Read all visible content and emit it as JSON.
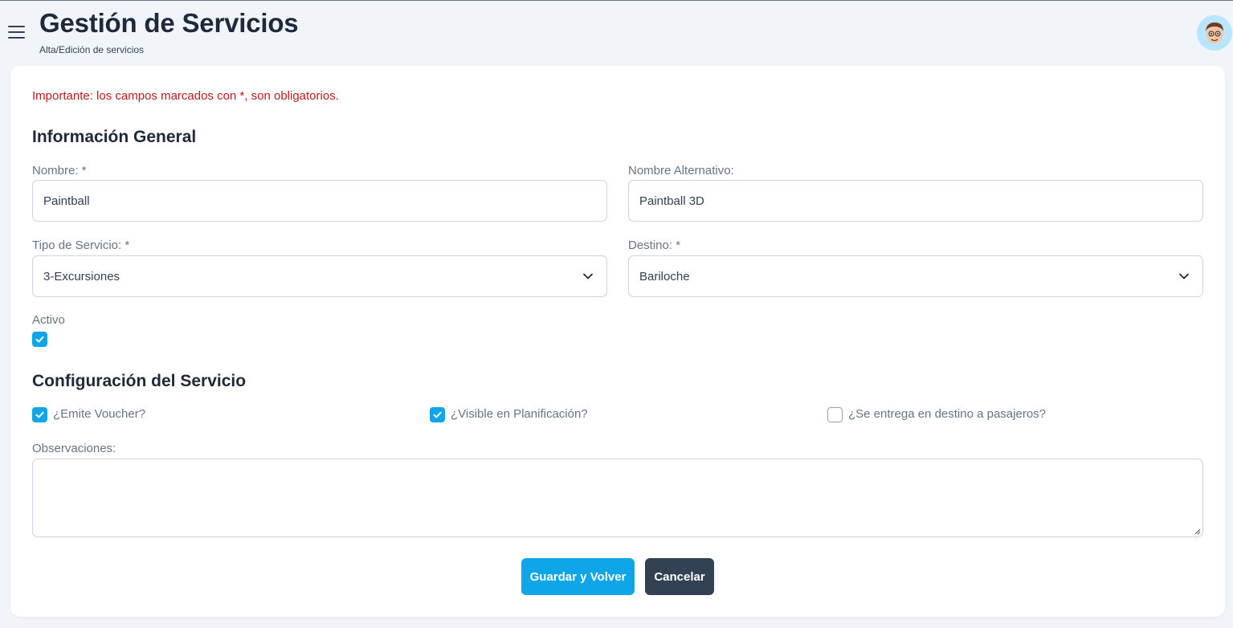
{
  "header": {
    "title": "Gestión de Servicios",
    "subtitle": "Alta/Edición de servicios"
  },
  "notice": "Importante: los campos marcados con *, son obligatorios.",
  "general": {
    "title": "Información General",
    "nombre": {
      "label": "Nombre: *",
      "value": "Paintball"
    },
    "nombre_alt": {
      "label": "Nombre Alternativo:",
      "value": "Paintball 3D"
    },
    "tipo": {
      "label": "Tipo de Servicio: *",
      "value": "3-Excursiones"
    },
    "destino": {
      "label": "Destino: *",
      "value": "Bariloche"
    },
    "activo": {
      "label": "Activo",
      "checked": true
    }
  },
  "config": {
    "title": "Configuración del Servicio",
    "emite_voucher": {
      "label": "¿Emite Voucher?",
      "checked": true
    },
    "visible_planificacion": {
      "label": "¿Visible en Planificación?",
      "checked": true
    },
    "entrega_destino": {
      "label": "¿Se entrega en destino a pasajeros?",
      "checked": false
    },
    "observaciones": {
      "label": "Observaciones:",
      "value": ""
    }
  },
  "actions": {
    "save_label": "Guardar y Volver",
    "cancel_label": "Cancelar"
  },
  "colors": {
    "accent": "#0ea5e9",
    "dark_button": "#334155",
    "notice": "#b91c1c"
  }
}
